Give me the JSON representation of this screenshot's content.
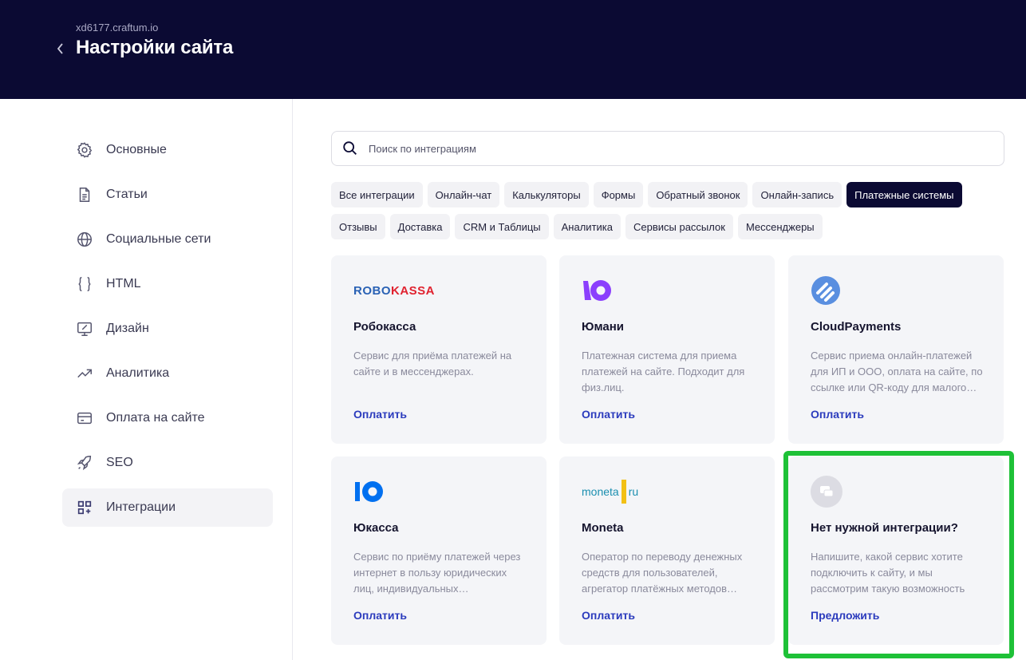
{
  "header": {
    "domain": "xd6177.craftum.io",
    "title": "Настройки сайта",
    "back_icon": "chevron-left-icon"
  },
  "sidebar": {
    "items": [
      {
        "label": "Основные",
        "icon": "gear-icon"
      },
      {
        "label": "Статьи",
        "icon": "document-icon"
      },
      {
        "label": "Социальные сети",
        "icon": "globe-icon"
      },
      {
        "label": "HTML",
        "icon": "braces-icon"
      },
      {
        "label": "Дизайн",
        "icon": "design-icon"
      },
      {
        "label": "Аналитика",
        "icon": "trend-icon"
      },
      {
        "label": "Оплата на сайте",
        "icon": "card-icon"
      },
      {
        "label": "SEO",
        "icon": "rocket-icon"
      },
      {
        "label": "Интеграции",
        "icon": "integrations-icon",
        "active": true
      }
    ]
  },
  "search": {
    "placeholder": "Поиск по интеграциям"
  },
  "filters": {
    "row1": [
      "Все интеграции",
      "Онлайн-чат",
      "Калькуляторы",
      "Формы",
      "Обратный звонок",
      "Онлайн-запись",
      "Платежные системы"
    ],
    "row2": [
      "Отзывы",
      "Доставка",
      "CRM и Таблицы",
      "Аналитика",
      "Сервисы рассылок",
      "Мессенджеры"
    ],
    "active": "Платежные системы"
  },
  "cards": [
    {
      "name": "Робокасса",
      "desc": "Сервис для приёма платежей на сайте и в мессенджерах.",
      "link": "Оплатить",
      "logo_text_a": "ROBO",
      "logo_text_b": "KASSA"
    },
    {
      "name": "Юмани",
      "desc": "Платежная система для приема платежей на сайте. Подходит для физ.лиц.",
      "link": "Оплатить"
    },
    {
      "name": "CloudPayments",
      "desc": "Сервис приема онлайн-платежей для ИП и ООО, оплата на сайте, по ссылке или QR-коду для малого…",
      "link": "Оплатить"
    },
    {
      "name": "Юкасса",
      "desc": "Сервис по приёму платежей через интернет в пользу юридических лиц, индивидуальных…",
      "link": "Оплатить"
    },
    {
      "name": "Moneta",
      "desc": "Оператор по переводу денежных средств для пользователей, агрегатор платёжных методов…",
      "link": "Оплатить",
      "logo_text_a": "moneta",
      "logo_text_b": "ru"
    },
    {
      "name": "Нет нужной интеграции?",
      "desc": "Напишите, какой сервис хотите подключить к сайту, и мы рассмотрим такую возможность",
      "link": "Предложить"
    }
  ],
  "colors": {
    "header_bg": "#0b0a33",
    "link": "#2b3bbd",
    "highlight": "#1ec137",
    "yoomoney": "#8b3ffd",
    "yookassa": "#0070f0",
    "cloudpayments": "#5a8fe0"
  }
}
